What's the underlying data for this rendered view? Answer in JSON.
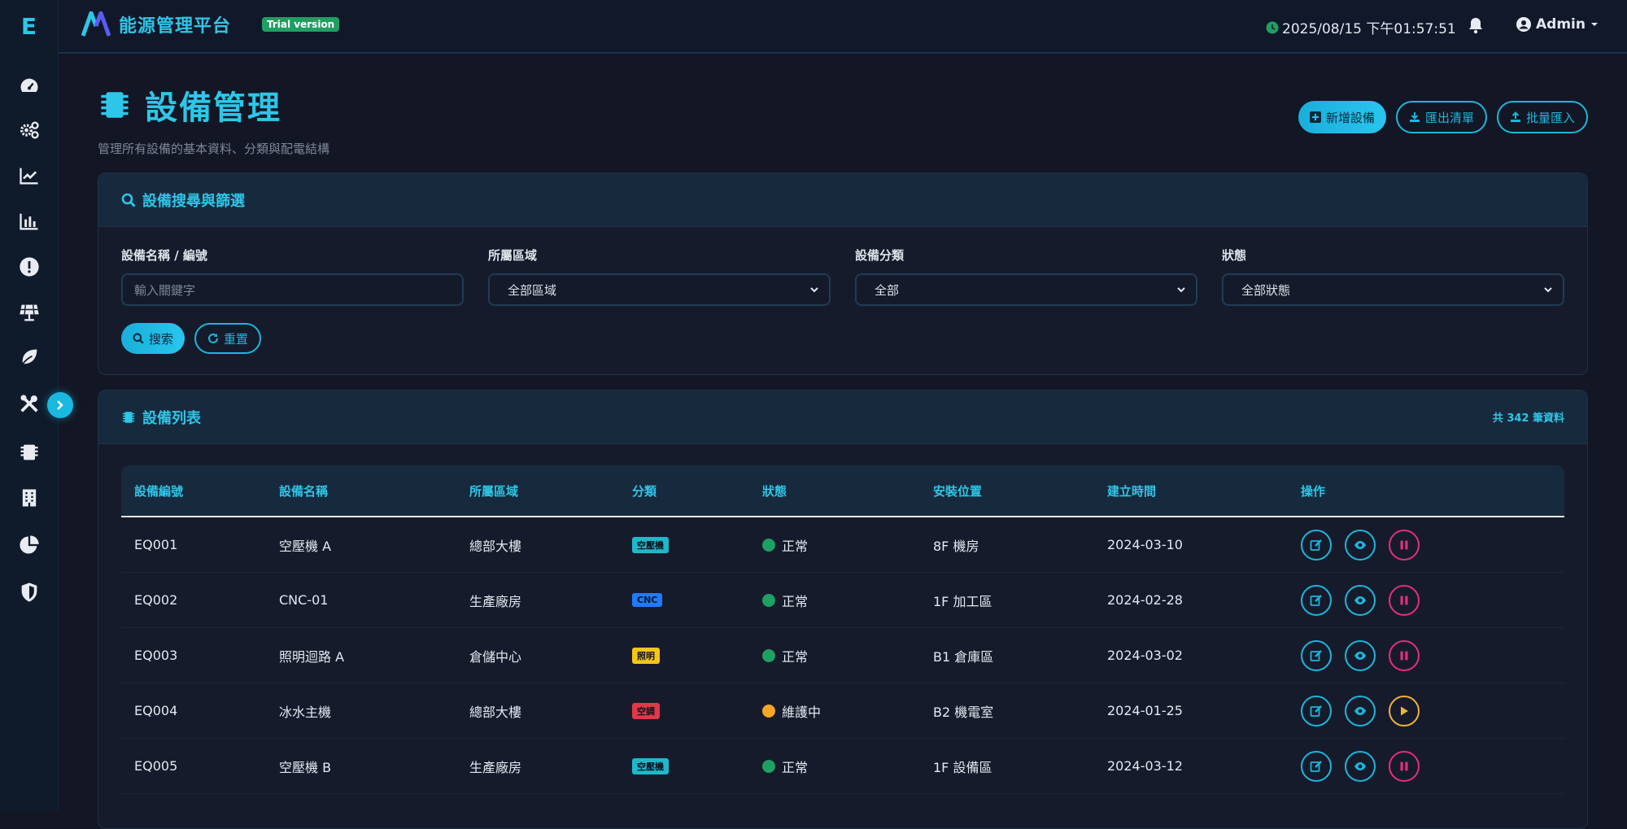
{
  "brand": {
    "logo_letter": "E",
    "title": "能源管理平台",
    "trial_badge": "Trial version"
  },
  "topbar": {
    "datetime": "2025/08/15 下午01:57:51",
    "user": "Admin"
  },
  "sidebar": {
    "items": [
      "gauge-icon",
      "gears-icon",
      "line-chart-icon",
      "bar-chart-icon",
      "alert-icon",
      "solar-panel-icon",
      "leaf-icon",
      "tools-icon",
      "chip-icon",
      "building-icon",
      "pie-chart-icon",
      "shield-icon"
    ]
  },
  "page": {
    "title": "設備管理",
    "subtitle": "管理所有設備的基本資料、分類與配電結構",
    "actions": {
      "add": "新增設備",
      "export": "匯出清單",
      "import": "批量匯入"
    }
  },
  "filter": {
    "title": "設備搜尋與篩選",
    "fields": [
      {
        "label": "設備名稱 / 編號",
        "placeholder": "輸入關鍵字"
      },
      {
        "label": "所屬區域",
        "value": "全部區域"
      },
      {
        "label": "設備分類",
        "value": "全部"
      },
      {
        "label": "狀態",
        "value": "全部狀態"
      }
    ],
    "search_label": "搜索",
    "reset_label": "重置"
  },
  "list": {
    "title": "設備列表",
    "count": "共 342 筆資料",
    "columns": [
      "設備編號",
      "設備名稱",
      "所屬區域",
      "分類",
      "狀態",
      "安裝位置",
      "建立時間",
      "操作"
    ],
    "rows": [
      {
        "id": "EQ001",
        "name": "空壓機 A",
        "area": "總部大樓",
        "category": "空壓機",
        "cat_color": "#20b8c9",
        "status": "正常",
        "status_color": "#1f9f62",
        "location": "8F 機房",
        "created": "2024-03-10",
        "toggle": "pause"
      },
      {
        "id": "EQ002",
        "name": "CNC-01",
        "area": "生產廠房",
        "category": "CNC",
        "cat_color": "#1f7bff",
        "status": "正常",
        "status_color": "#1f9f62",
        "location": "1F 加工區",
        "created": "2024-02-28",
        "toggle": "pause"
      },
      {
        "id": "EQ003",
        "name": "照明迴路 A",
        "area": "倉儲中心",
        "category": "照明",
        "cat_color": "#f5c518",
        "status": "正常",
        "status_color": "#1f9f62",
        "location": "B1 倉庫區",
        "created": "2024-03-02",
        "toggle": "pause"
      },
      {
        "id": "EQ004",
        "name": "冰水主機",
        "area": "總部大樓",
        "category": "空調",
        "cat_color": "#e0394a",
        "status": "維護中",
        "status_color": "#f5a623",
        "location": "B2 機電室",
        "created": "2024-01-25",
        "toggle": "play"
      },
      {
        "id": "EQ005",
        "name": "空壓機 B",
        "area": "生產廠房",
        "category": "空壓機",
        "cat_color": "#20b8c9",
        "status": "正常",
        "status_color": "#1f9f62",
        "location": "1F 設備區",
        "created": "2024-03-12",
        "toggle": "pause"
      }
    ]
  }
}
